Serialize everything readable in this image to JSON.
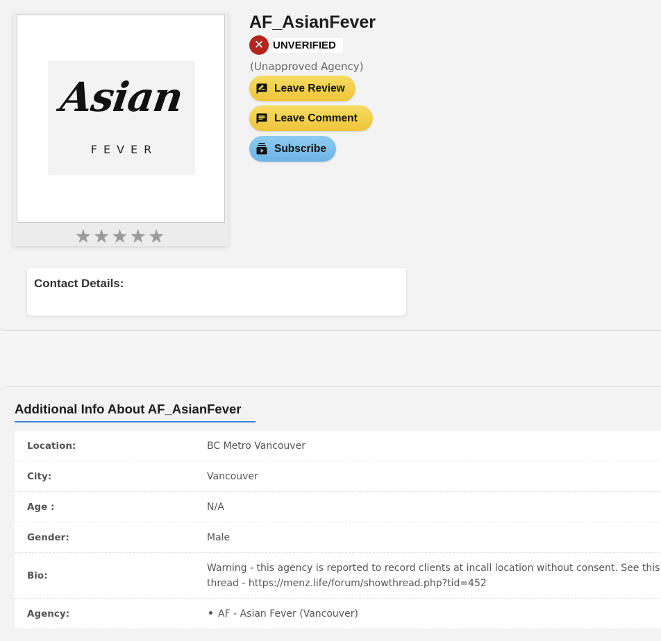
{
  "profile": {
    "title": "AF_AsianFever",
    "status": "UNVERIFIED",
    "agency_note": "(Unapproved Agency)",
    "logo_text": "Asian",
    "logo_subtext": "FEVER",
    "rating_stars": "★★★★★",
    "rating": 0
  },
  "actions": {
    "review_label": "Leave Review",
    "comment_label": "Leave Comment",
    "subscribe_label": "Subscribe"
  },
  "contact": {
    "title": "Contact Details:"
  },
  "info": {
    "heading": "Additional Info About AF_AsianFever",
    "rows": [
      {
        "label": "Location:",
        "value": "BC Metro Vancouver"
      },
      {
        "label": "City:",
        "value": "Vancouver"
      },
      {
        "label": "Age :",
        "value": "N/A"
      },
      {
        "label": "Gender:",
        "value": "Male"
      },
      {
        "label": "Bio:",
        "value": "Warning - this agency is reported to record clients at incall location without consent. See this thread - https://menz.life/forum/showthread.php?tid=452"
      },
      {
        "label": "Agency:",
        "value": "AF - Asian Fever (Vancouver)"
      }
    ]
  },
  "colors": {
    "accent_yellow": "#eec43a",
    "accent_blue": "#6cb4e6",
    "unverified_red": "#b3261e",
    "heading_underline": "#3a7fd6"
  }
}
